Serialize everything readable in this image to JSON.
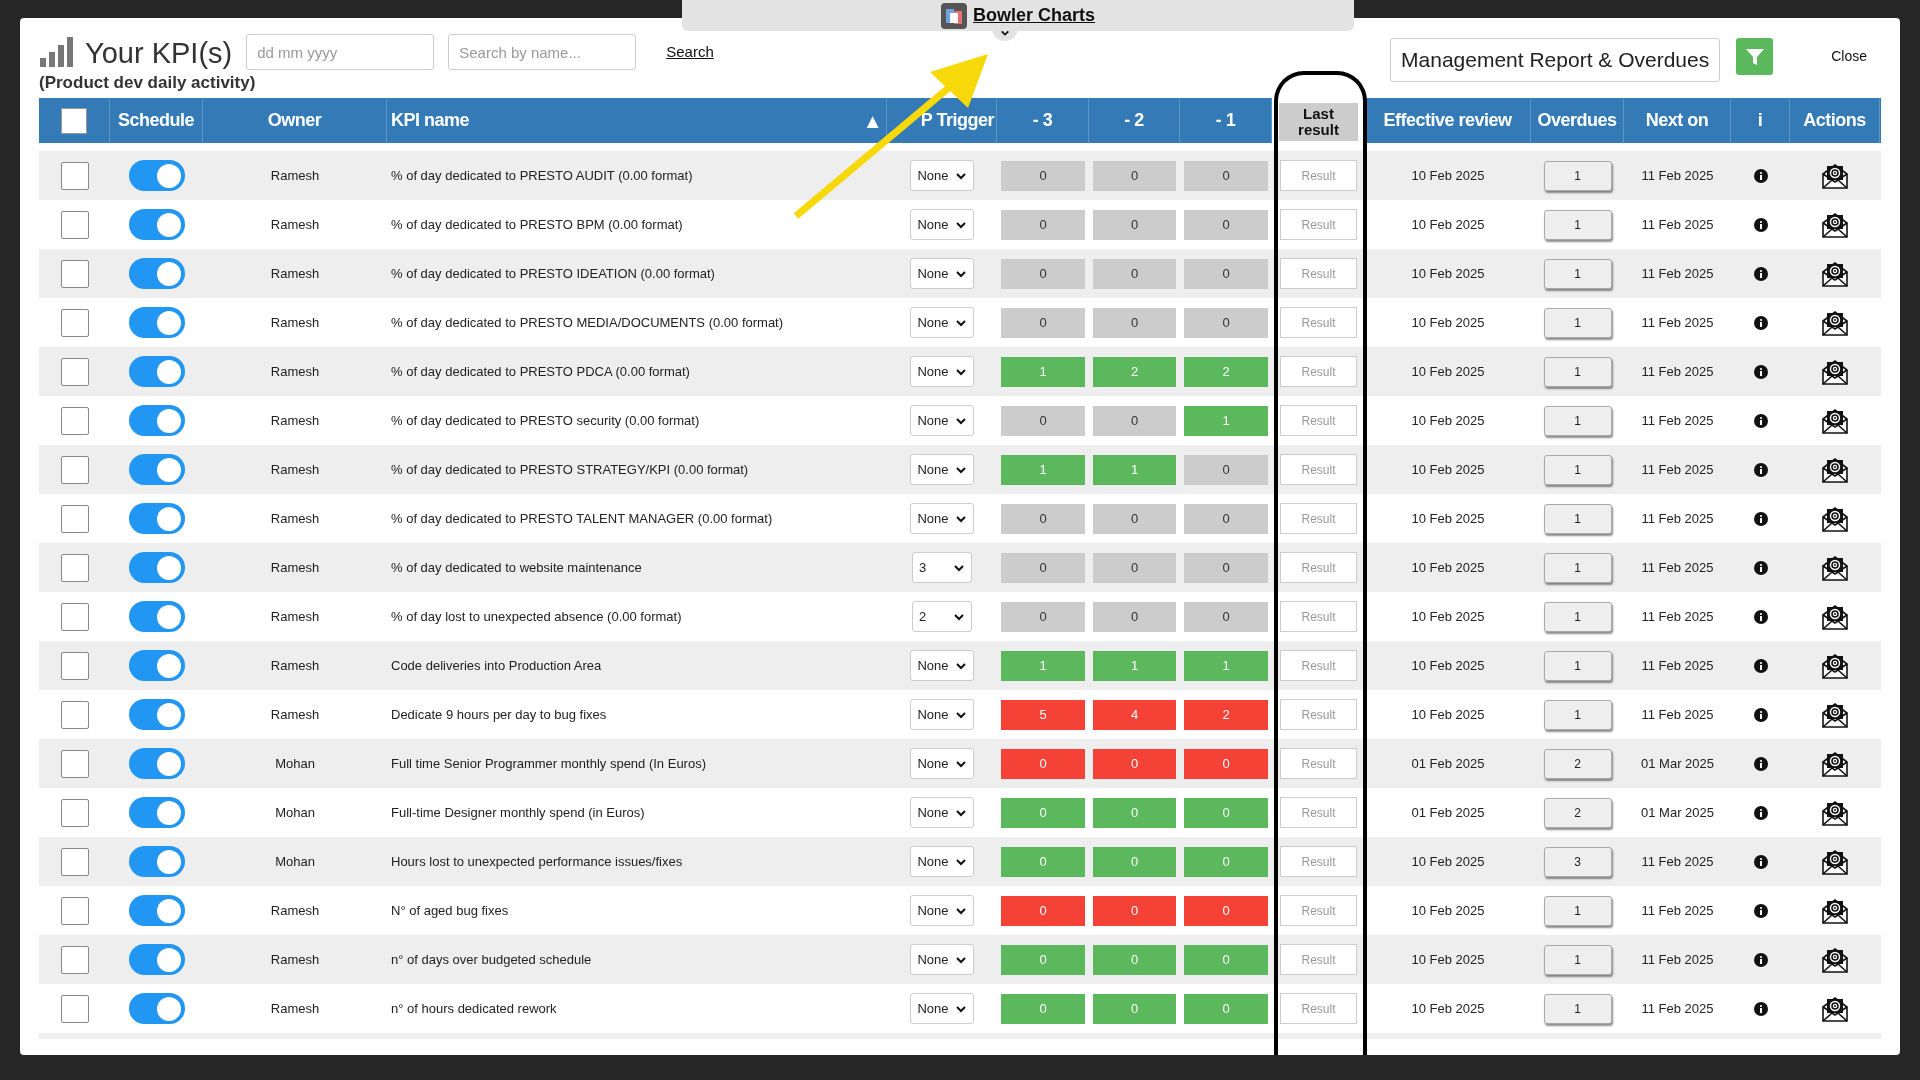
{
  "bowler_tab": {
    "title": "Bowler Charts"
  },
  "header": {
    "title": "Your KPI(s)",
    "subtitle": "(Product dev daily activity)",
    "date_field": {
      "placeholder": "dd mm yyyy"
    },
    "search_field": {
      "placeholder": "Search by name..."
    },
    "search_link": "Search",
    "report_button": "Management Report & Overdues",
    "close": "Close"
  },
  "table": {
    "columns": [
      "Schedule",
      "Owner",
      "KPI name",
      "P Trigger",
      "- 3",
      "- 2",
      "- 1",
      "Last result",
      "Effective review",
      "Overdues",
      "Next on",
      "i",
      "Actions"
    ],
    "sort_indicator": "▲",
    "select_all_checked": false,
    "rows": [
      {
        "checked": false,
        "schedule_on": true,
        "owner": "Ramesh",
        "kpi": "% of day dedicated to PRESTO AUDIT (0.00 format)",
        "trigger": "None",
        "values": [
          {
            "value": "0",
            "color": "#cccccc"
          },
          {
            "value": "0",
            "color": "#cccccc"
          },
          {
            "value": "0",
            "color": "#cccccc"
          }
        ],
        "result_placeholder": "Result",
        "effective_review": "10 Feb 2025",
        "overdues": "1",
        "next_on": "11 Feb 2025"
      },
      {
        "checked": false,
        "schedule_on": true,
        "owner": "Ramesh",
        "kpi": "% of day dedicated to PRESTO BPM (0.00 format)",
        "trigger": "None",
        "values": [
          {
            "value": "0",
            "color": "#cccccc"
          },
          {
            "value": "0",
            "color": "#cccccc"
          },
          {
            "value": "0",
            "color": "#cccccc"
          }
        ],
        "result_placeholder": "Result",
        "effective_review": "10 Feb 2025",
        "overdues": "1",
        "next_on": "11 Feb 2025"
      },
      {
        "checked": false,
        "schedule_on": true,
        "owner": "Ramesh",
        "kpi": "% of day dedicated to PRESTO IDEATION (0.00 format)",
        "trigger": "None",
        "values": [
          {
            "value": "0",
            "color": "#cccccc"
          },
          {
            "value": "0",
            "color": "#cccccc"
          },
          {
            "value": "0",
            "color": "#cccccc"
          }
        ],
        "result_placeholder": "Result",
        "effective_review": "10 Feb 2025",
        "overdues": "1",
        "next_on": "11 Feb 2025"
      },
      {
        "checked": false,
        "schedule_on": true,
        "owner": "Ramesh",
        "kpi": "% of day dedicated to PRESTO MEDIA/DOCUMENTS (0.00 format)",
        "trigger": "None",
        "values": [
          {
            "value": "0",
            "color": "#cccccc"
          },
          {
            "value": "0",
            "color": "#cccccc"
          },
          {
            "value": "0",
            "color": "#cccccc"
          }
        ],
        "result_placeholder": "Result",
        "effective_review": "10 Feb 2025",
        "overdues": "1",
        "next_on": "11 Feb 2025"
      },
      {
        "checked": false,
        "schedule_on": true,
        "owner": "Ramesh",
        "kpi": "% of day dedicated to PRESTO PDCA (0.00 format)",
        "trigger": "None",
        "values": [
          {
            "value": "1",
            "color": "#5cb85c"
          },
          {
            "value": "2",
            "color": "#5cb85c"
          },
          {
            "value": "2",
            "color": "#5cb85c"
          }
        ],
        "result_placeholder": "Result",
        "effective_review": "10 Feb 2025",
        "overdues": "1",
        "next_on": "11 Feb 2025"
      },
      {
        "checked": false,
        "schedule_on": true,
        "owner": "Ramesh",
        "kpi": "% of day dedicated to PRESTO security (0.00 format)",
        "trigger": "None",
        "values": [
          {
            "value": "0",
            "color": "#cccccc"
          },
          {
            "value": "0",
            "color": "#cccccc"
          },
          {
            "value": "1",
            "color": "#5cb85c"
          }
        ],
        "result_placeholder": "Result",
        "effective_review": "10 Feb 2025",
        "overdues": "1",
        "next_on": "11 Feb 2025"
      },
      {
        "checked": false,
        "schedule_on": true,
        "owner": "Ramesh",
        "kpi": "% of day dedicated to PRESTO STRATEGY/KPI (0.00 format)",
        "trigger": "None",
        "values": [
          {
            "value": "1",
            "color": "#5cb85c"
          },
          {
            "value": "1",
            "color": "#5cb85c"
          },
          {
            "value": "0",
            "color": "#cccccc"
          }
        ],
        "result_placeholder": "Result",
        "effective_review": "10 Feb 2025",
        "overdues": "1",
        "next_on": "11 Feb 2025"
      },
      {
        "checked": false,
        "schedule_on": true,
        "owner": "Ramesh",
        "kpi": "% of day dedicated to PRESTO TALENT MANAGER (0.00 format)",
        "trigger": "None",
        "values": [
          {
            "value": "0",
            "color": "#cccccc"
          },
          {
            "value": "0",
            "color": "#cccccc"
          },
          {
            "value": "0",
            "color": "#cccccc"
          }
        ],
        "result_placeholder": "Result",
        "effective_review": "10 Feb 2025",
        "overdues": "1",
        "next_on": "11 Feb 2025"
      },
      {
        "checked": false,
        "schedule_on": true,
        "owner": "Ramesh",
        "kpi": "% of day dedicated to website maintenance",
        "trigger": "3",
        "values": [
          {
            "value": "0",
            "color": "#cccccc"
          },
          {
            "value": "0",
            "color": "#cccccc"
          },
          {
            "value": "0",
            "color": "#cccccc"
          }
        ],
        "result_placeholder": "Result",
        "effective_review": "10 Feb 2025",
        "overdues": "1",
        "next_on": "11 Feb 2025"
      },
      {
        "checked": false,
        "schedule_on": true,
        "owner": "Ramesh",
        "kpi": "% of day lost to unexpected absence (0.00 format)",
        "trigger": "2",
        "values": [
          {
            "value": "0",
            "color": "#cccccc"
          },
          {
            "value": "0",
            "color": "#cccccc"
          },
          {
            "value": "0",
            "color": "#cccccc"
          }
        ],
        "result_placeholder": "Result",
        "effective_review": "10 Feb 2025",
        "overdues": "1",
        "next_on": "11 Feb 2025"
      },
      {
        "checked": false,
        "schedule_on": true,
        "owner": "Ramesh",
        "kpi": "Code deliveries into Production Area",
        "trigger": "None",
        "values": [
          {
            "value": "1",
            "color": "#5cb85c"
          },
          {
            "value": "1",
            "color": "#5cb85c"
          },
          {
            "value": "1",
            "color": "#5cb85c"
          }
        ],
        "result_placeholder": "Result",
        "effective_review": "10 Feb 2025",
        "overdues": "1",
        "next_on": "11 Feb 2025"
      },
      {
        "checked": false,
        "schedule_on": true,
        "owner": "Ramesh",
        "kpi": "Dedicate 9 hours per day to bug fixes",
        "trigger": "None",
        "values": [
          {
            "value": "5",
            "color": "#f44336"
          },
          {
            "value": "4",
            "color": "#f44336"
          },
          {
            "value": "2",
            "color": "#f44336"
          }
        ],
        "result_placeholder": "Result",
        "effective_review": "10 Feb 2025",
        "overdues": "1",
        "next_on": "11 Feb 2025"
      },
      {
        "checked": false,
        "schedule_on": true,
        "owner": "Mohan",
        "kpi": "Full time Senior Programmer monthly spend (In Euros)",
        "trigger": "None",
        "values": [
          {
            "value": "0",
            "color": "#f44336"
          },
          {
            "value": "0",
            "color": "#f44336"
          },
          {
            "value": "0",
            "color": "#f44336"
          }
        ],
        "result_placeholder": "Result",
        "effective_review": "01 Feb 2025",
        "overdues": "2",
        "next_on": "01 Mar 2025"
      },
      {
        "checked": false,
        "schedule_on": true,
        "owner": "Mohan",
        "kpi": "Full-time Designer monthly spend (in Euros)",
        "trigger": "None",
        "values": [
          {
            "value": "0",
            "color": "#5cb85c"
          },
          {
            "value": "0",
            "color": "#5cb85c"
          },
          {
            "value": "0",
            "color": "#5cb85c"
          }
        ],
        "result_placeholder": "Result",
        "effective_review": "01 Feb 2025",
        "overdues": "2",
        "next_on": "01 Mar 2025"
      },
      {
        "checked": false,
        "schedule_on": true,
        "owner": "Mohan",
        "kpi": "Hours lost to unexpected performance issues/fixes",
        "trigger": "None",
        "values": [
          {
            "value": "0",
            "color": "#5cb85c"
          },
          {
            "value": "0",
            "color": "#5cb85c"
          },
          {
            "value": "0",
            "color": "#5cb85c"
          }
        ],
        "result_placeholder": "Result",
        "effective_review": "10 Feb 2025",
        "overdues": "3",
        "next_on": "11 Feb 2025"
      },
      {
        "checked": false,
        "schedule_on": true,
        "owner": "Ramesh",
        "kpi": "N° of aged bug fixes",
        "trigger": "None",
        "values": [
          {
            "value": "0",
            "color": "#f44336"
          },
          {
            "value": "0",
            "color": "#f44336"
          },
          {
            "value": "0",
            "color": "#f44336"
          }
        ],
        "result_placeholder": "Result",
        "effective_review": "10 Feb 2025",
        "overdues": "1",
        "next_on": "11 Feb 2025"
      },
      {
        "checked": false,
        "schedule_on": true,
        "owner": "Ramesh",
        "kpi": "n° of days over budgeted schedule",
        "trigger": "None",
        "values": [
          {
            "value": "0",
            "color": "#5cb85c"
          },
          {
            "value": "0",
            "color": "#5cb85c"
          },
          {
            "value": "0",
            "color": "#5cb85c"
          }
        ],
        "result_placeholder": "Result",
        "effective_review": "10 Feb 2025",
        "overdues": "1",
        "next_on": "11 Feb 2025"
      },
      {
        "checked": false,
        "schedule_on": true,
        "owner": "Ramesh",
        "kpi": "n° of hours dedicated rework",
        "trigger": "None",
        "values": [
          {
            "value": "0",
            "color": "#5cb85c"
          },
          {
            "value": "0",
            "color": "#5cb85c"
          },
          {
            "value": "0",
            "color": "#5cb85c"
          }
        ],
        "result_placeholder": "Result",
        "effective_review": "10 Feb 2025",
        "overdues": "1",
        "next_on": "11 Feb 2025"
      }
    ]
  }
}
